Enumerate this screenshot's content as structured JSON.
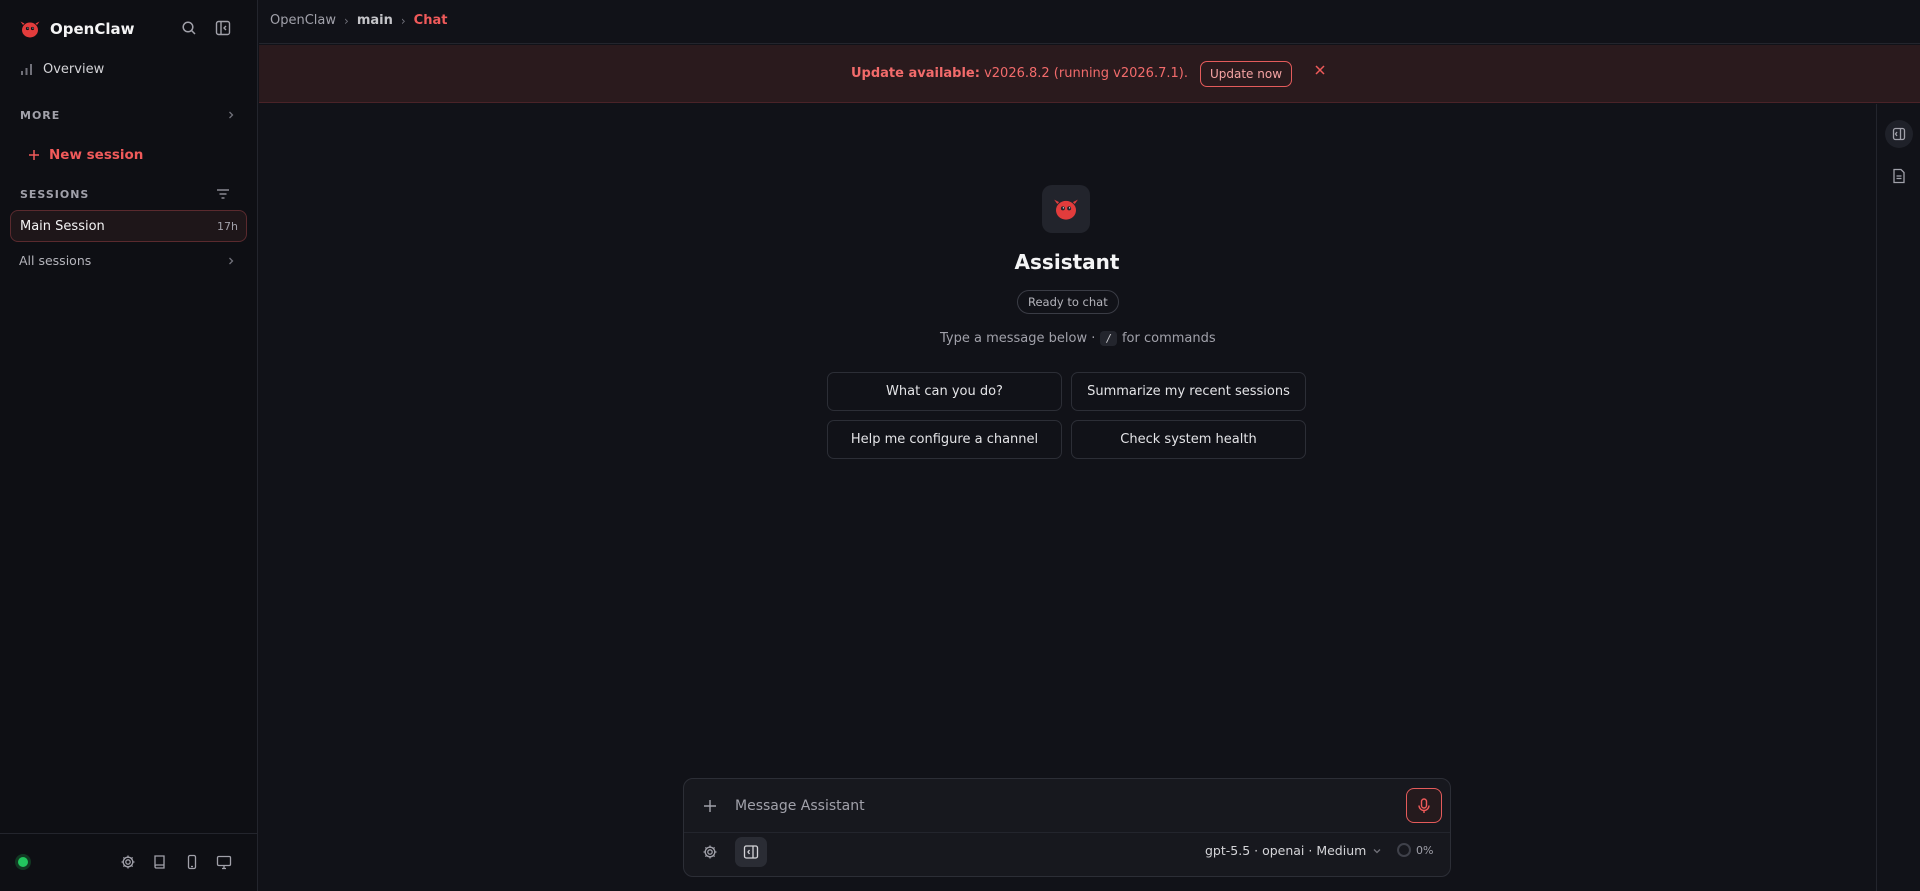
{
  "app": {
    "name": "OpenClaw"
  },
  "sidebar": {
    "overview_label": "Overview",
    "more_label": "MORE",
    "new_session_label": "New session",
    "sessions_label": "SESSIONS",
    "sessions": [
      {
        "name": "Main Session",
        "age": "17h"
      }
    ],
    "all_sessions_label": "All sessions",
    "status_color": "#22c55e"
  },
  "breadcrumb": [
    "OpenClaw",
    "main",
    "Chat"
  ],
  "banner": {
    "title": "Update available:",
    "message": "v2026.8.2 (running v2026.7.1).",
    "button": "Update now"
  },
  "welcome": {
    "title": "Assistant",
    "status": "Ready to chat",
    "hint_before": "Type a message below ·",
    "hint_key": "/",
    "hint_after": "for commands",
    "suggestions": [
      "What can you do?",
      "Summarize my recent sessions",
      "Help me configure a channel",
      "Check system health"
    ]
  },
  "composer": {
    "placeholder": "Message Assistant",
    "model": "gpt-5.5 · openai · Medium",
    "context": "0%"
  },
  "colors": {
    "accent": "#f05a5a",
    "background": "#111218",
    "sidebar": "#0e0f14",
    "banner": "#2a1a1d"
  },
  "icons": {
    "brand": "lobster-icon",
    "search": "search-icon",
    "collapse": "sidebar-collapse-icon",
    "overview": "bar-chart-icon",
    "filter": "filter-icon",
    "settings": "gear-icon",
    "docs": "book-icon",
    "mobile": "phone-icon",
    "desktop": "monitor-icon",
    "mic": "microphone-icon",
    "close": "close-icon"
  }
}
